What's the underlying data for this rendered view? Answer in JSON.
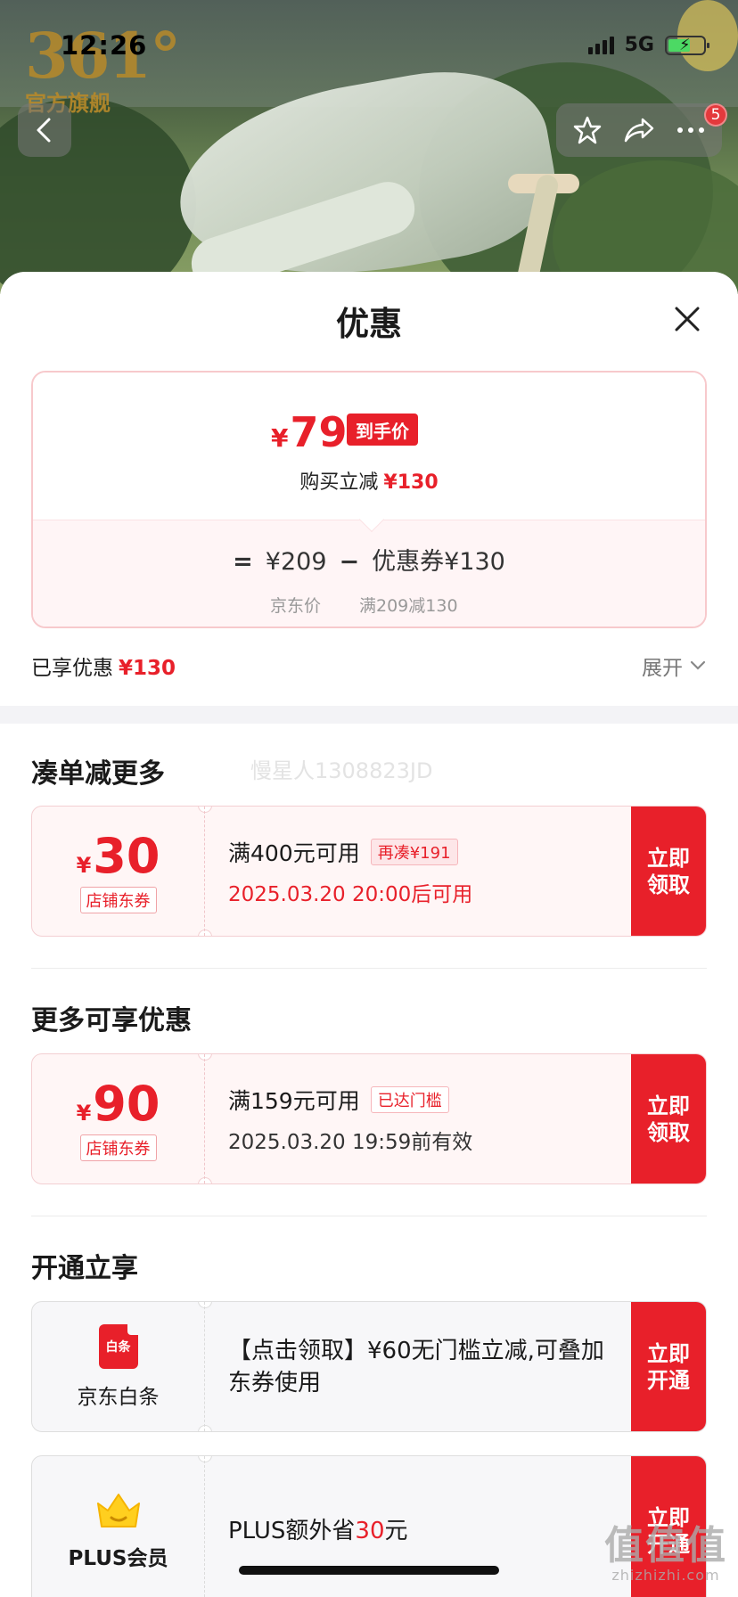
{
  "status_bar": {
    "time": "12:26",
    "network": "5G"
  },
  "brand": {
    "logo_number": "361°",
    "logo_sub": "官方旗舰"
  },
  "nav": {
    "cart_badge": "5"
  },
  "sheet": {
    "title": "优惠"
  },
  "price_breakdown": {
    "currency": "¥",
    "final_price": "79",
    "final_tag": "到手价",
    "buy_reduce_label": "购买立减",
    "buy_reduce_value": "¥130",
    "equals": "=",
    "base_price": "¥209",
    "minus": "−",
    "coupon_label": "优惠券¥130",
    "base_price_caption": "京东价",
    "coupon_caption": "满209减130"
  },
  "summary": {
    "enjoyed_label": "已享优惠",
    "enjoyed_value": "¥130",
    "expand_label": "展开"
  },
  "sections": {
    "more_order": {
      "title": "凑单减更多",
      "watermark": "慢星人1308823JD"
    },
    "more_offers": {
      "title": "更多可享优惠"
    },
    "activate": {
      "title": "开通立享"
    }
  },
  "coupons": [
    {
      "currency": "¥",
      "amount": "30",
      "type": "店铺东券",
      "condition": "满400元可用",
      "chip": "再凑¥191",
      "time": "2025.03.20 20:00后可用",
      "action": "立即领取"
    },
    {
      "currency": "¥",
      "amount": "90",
      "type": "店铺东券",
      "condition": "满159元可用",
      "chip": "已达门槛",
      "time": "2025.03.20 19:59前有效",
      "action": "立即领取"
    }
  ],
  "activations": [
    {
      "icon_text": "白条",
      "label": "京东白条",
      "desc": "【点击领取】¥60无门槛立减,可叠加东券使用",
      "action": "立即开通"
    },
    {
      "label": "PLUS会员",
      "desc_prefix": "PLUS额外省",
      "desc_value": "30",
      "desc_suffix": "元",
      "action": "立即开通"
    }
  ],
  "watermark_site": {
    "big": "值值值",
    "small": "zhizhizhi.com"
  },
  "colors": {
    "accent": "#e8202a",
    "soft_red_bg": "#fff6f6",
    "band": "#f3f3f6"
  }
}
